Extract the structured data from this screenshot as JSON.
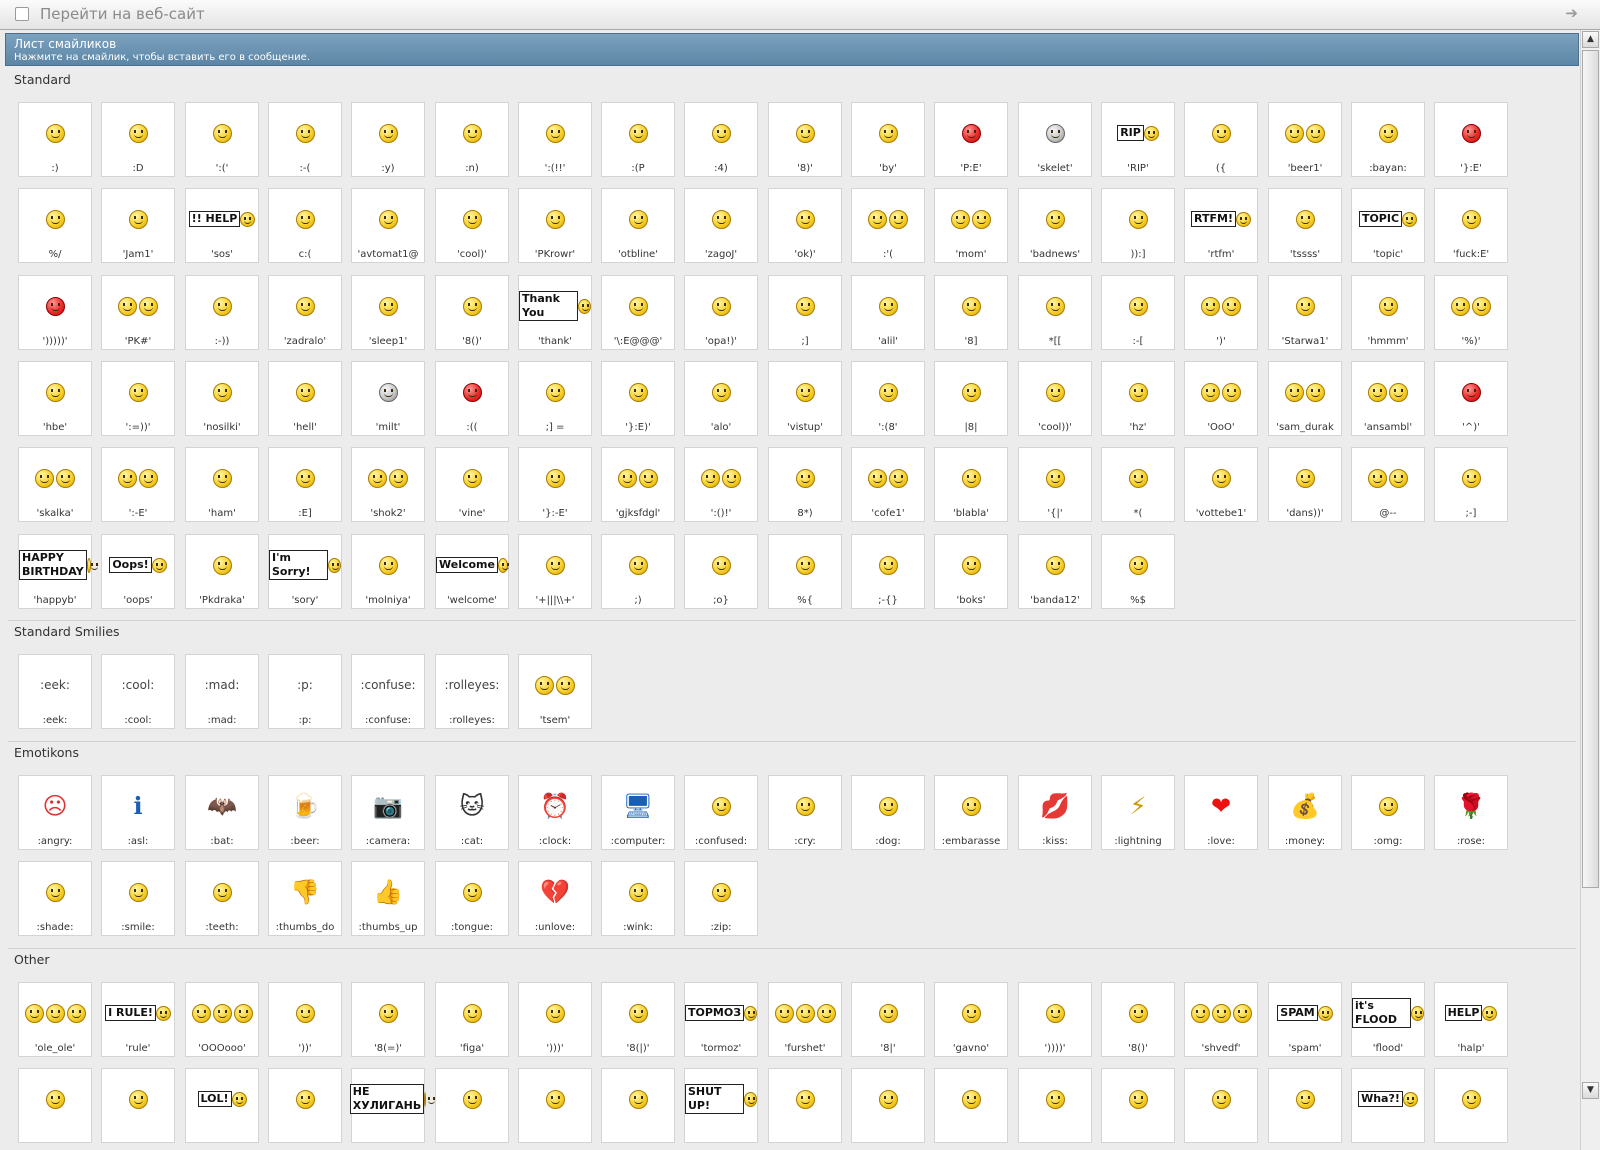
{
  "address_bar": {
    "placeholder": "Перейти на веб-сайт"
  },
  "header": {
    "title": "Лист смайликов",
    "subtitle": "Нажмите на смайлик, чтобы вставить его в сообщение."
  },
  "sections": [
    {
      "title": "Standard",
      "items": [
        ":)",
        ":D",
        "':('",
        ":-(",
        ":y)",
        ":n)",
        "':(!!'",
        ":(P",
        ":4)",
        "'8)'",
        "'by'",
        "'P:E'",
        "'skelet'",
        "'RIP'",
        "({",
        "'beer1'",
        ":bayan:",
        "'}:E'",
        "%/",
        "'Jam1'",
        "'sos'",
        "c:(",
        "'avtomat1@",
        "'cool)'",
        "'PKrowr'",
        "'otbline'",
        "'zagoJ'",
        "'ok)'",
        ":'(",
        "'mom'",
        "'badnews'",
        ")):]",
        "'rtfm'",
        "'tssss'",
        "'topic'",
        "'fuck:E'",
        "')))))'",
        "'PK#'",
        ":-))",
        "'zadralo'",
        "'sleep1'",
        "'8()'",
        "'thank'",
        "'\\:E@@@'",
        "'opa!)'",
        ";]",
        "'alil'",
        "'8]",
        "*[[",
        ":-[",
        "')'",
        "'Starwa1'",
        "'hmmm'",
        "'%)'",
        "'hbe'",
        "':=))'",
        "'nosilki'",
        "'hell'",
        "'milt'",
        ":((",
        ";] =",
        "'}:E)'",
        "'alo'",
        "'vistup'",
        "':(8'",
        "|8|",
        "'cool))'",
        "'hz'",
        "'OoO'",
        "'sam_durak",
        "'ansambl'",
        "'^)'",
        "'skalka'",
        "':-E'",
        "'ham'",
        ":E]",
        "'shok2'",
        "'vine'",
        "'}:-E'",
        "'gjksfdgl'",
        "':()!'",
        "8*)",
        "'cofe1'",
        "'blabla'",
        "'{|'",
        "*(",
        "'vottebe1'",
        "'dans))'",
        "@--",
        ";-]",
        "'happyb'",
        "'oops'",
        "'Pkdraka'",
        "'sory'",
        "'molniya'",
        "'welcome'",
        "'+|||\\\\+'",
        ";)",
        ";o}",
        "%{",
        ";-{}",
        "'boks'",
        "'banda12'",
        "%$"
      ]
    },
    {
      "title": "Standard Smilies",
      "items": [
        {
          "label": ":eek:",
          "code": ":eek:"
        },
        {
          "label": ":cool:",
          "code": ":cool:"
        },
        {
          "label": ":mad:",
          "code": ":mad:"
        },
        {
          "label": ":p:",
          "code": ":p:"
        },
        {
          "label": ":confuse:",
          "code": ":confuse:"
        },
        {
          "label": ":rolleyes:",
          "code": ":rolleyes:"
        },
        {
          "label": "",
          "code": "'tsem'"
        }
      ]
    },
    {
      "title": "Emotikons",
      "items": [
        ":angry:",
        ":asl:",
        ":bat:",
        ":beer:",
        ":camera:",
        ":cat:",
        ":clock:",
        ":computer:",
        ":confused:",
        ":cry:",
        ":dog:",
        ":embarasse",
        ":kiss:",
        ":lightning",
        ":love:",
        ":money:",
        ":omg:",
        ":rose:",
        ":shade:",
        ":smile:",
        ":teeth:",
        ":thumbs_do",
        ":thumbs_up",
        ":tongue:",
        ":unlove:",
        ":wink:",
        ":zip:"
      ]
    },
    {
      "title": "Other",
      "items": [
        "'ole_ole'",
        "'rule'",
        "'OOOooo'",
        "'))'",
        "'8(=)'",
        "'figa'",
        "')))'",
        "'8(|)'",
        "'tormoz'",
        "'furshet'",
        "'8|'",
        "'gavno'",
        "'))))'",
        "'8()'",
        "'shvedf'",
        "'spam'",
        "'flood'",
        "'halp'",
        "",
        "",
        "",
        "",
        "",
        "",
        "",
        "",
        "",
        "",
        "",
        "",
        "",
        "",
        "",
        "",
        "",
        ""
      ]
    }
  ],
  "sign_texts": {
    "thank": "Thank You",
    "rtfm": "RTFM!",
    "topic": "TOPIC",
    "help": "!! HELP",
    "oops": "Oops!",
    "sorry": "I'm Sorry!",
    "welcome": "Welcome",
    "happyb": "HAPPY BIRTHDAY",
    "rule": "I RULE!",
    "tormoz": "ТОРМОЗ",
    "flood": "it's FLOOD",
    "spam": "SPAM",
    "halp": "HELP",
    "lol": "LOL!",
    "ne_huliganyu": "НЕ ХУЛИГАНЬ",
    "shut_up": "SHUT UP!",
    "wha": "Wha?!",
    "rip": "RIP"
  },
  "icons": {
    "reset": "checkbox-icon",
    "go": "arrow-right-icon"
  },
  "colors": {
    "header_bg": "#6a92b0",
    "tile_bg": "#ffffff",
    "page_bg": "#ececec"
  }
}
